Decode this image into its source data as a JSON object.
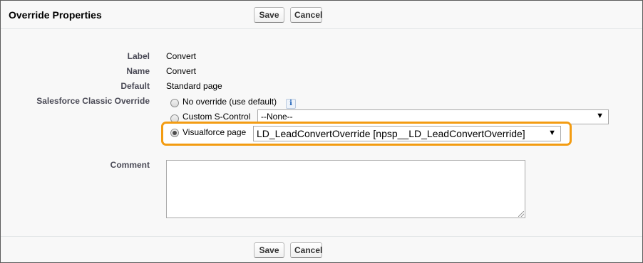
{
  "header": {
    "title": "Override Properties"
  },
  "buttons": {
    "save": "Save",
    "cancel": "Cancel"
  },
  "fields": {
    "label": {
      "label": "Label",
      "value": "Convert"
    },
    "name": {
      "label": "Name",
      "value": "Convert"
    },
    "default": {
      "label": "Default",
      "value": "Standard page"
    },
    "classic_override": {
      "label": "Salesforce Classic Override",
      "options": {
        "no_override": "No override (use default)",
        "s_control": "Custom S-Control",
        "visualforce": "Visualforce page"
      },
      "selected": "visualforce",
      "s_control_value": "--None--",
      "visualforce_value": "LD_LeadConvertOverride [npsp__LD_LeadConvertOverride]",
      "info_icon": "i"
    },
    "comment": {
      "label": "Comment",
      "value": ""
    }
  },
  "colors": {
    "highlight": "#f39c12",
    "label_text": "#4a4a56"
  },
  "icons": {
    "info": "info-icon",
    "dropdown": "chevron-down-icon",
    "resize": "resize-grip-icon"
  }
}
